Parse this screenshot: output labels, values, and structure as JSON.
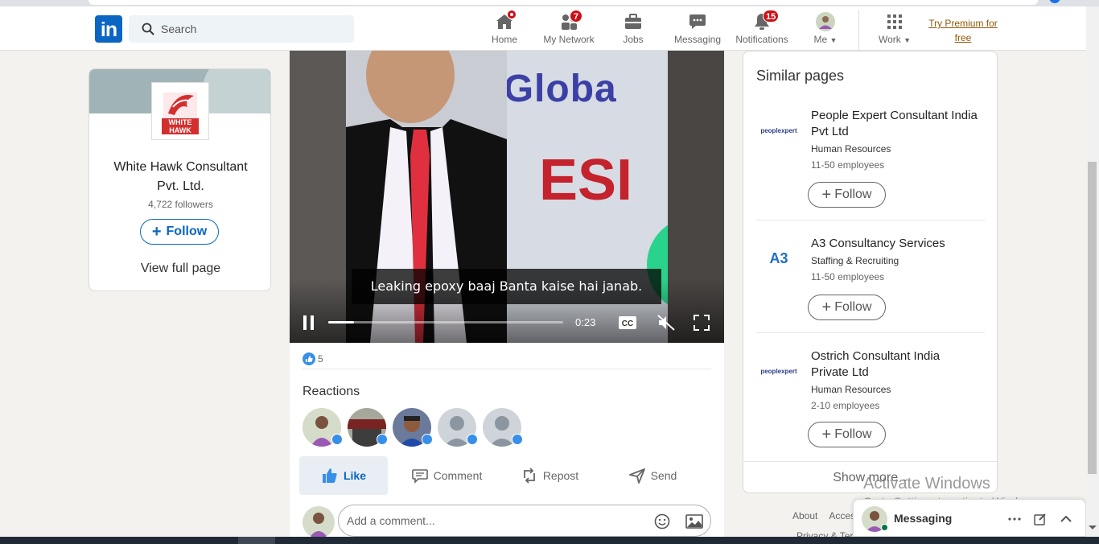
{
  "nav": {
    "logo": "in",
    "search_placeholder": "Search",
    "items": [
      {
        "label": "Home",
        "icon": "home-icon",
        "badge": ""
      },
      {
        "label": "My Network",
        "icon": "network-icon",
        "badge": "7"
      },
      {
        "label": "Jobs",
        "icon": "briefcase-icon",
        "badge": ""
      },
      {
        "label": "Messaging",
        "icon": "chat-icon",
        "badge": ""
      },
      {
        "label": "Notifications",
        "icon": "bell-icon",
        "badge": "15"
      },
      {
        "label": "Me",
        "icon": "avatar",
        "badge": ""
      },
      {
        "label": "Work",
        "icon": "grid-icon",
        "badge": ""
      }
    ],
    "premium": "Try Premium for free"
  },
  "company_card": {
    "name": "White Hawk Consultant Pvt. Ltd.",
    "followers": "4,722 followers",
    "follow_label": "Follow",
    "view_full": "View full page",
    "logo_text": "WHITE HAWK"
  },
  "post": {
    "video": {
      "banner_text": "am Globa",
      "banner_red": "ESI",
      "caption": "Leaking epoxy baaj Banta kaise hai janab.",
      "time": "0:23",
      "progress": 0.11
    },
    "like_count": "5",
    "reactions_title": "Reactions",
    "actions": [
      {
        "label": "Like",
        "icon": "like-icon"
      },
      {
        "label": "Comment",
        "icon": "comment-icon"
      },
      {
        "label": "Repost",
        "icon": "repost-icon"
      },
      {
        "label": "Send",
        "icon": "send-icon"
      }
    ],
    "comment_placeholder": "Add a comment..."
  },
  "similar": {
    "title": "Similar pages",
    "pages": [
      {
        "name": "People Expert Consultant India Pvt Ltd",
        "industry": "Human Resources",
        "size": "11-50 employees",
        "logo": "peoplexpert"
      },
      {
        "name": "A3 Consultancy Services",
        "industry": "Staffing & Recruiting",
        "size": "11-50 employees",
        "logo": "A3"
      },
      {
        "name": "Ostrich Consultant India Private Ltd",
        "industry": "Human Resources",
        "size": "2-10 employees",
        "logo": "peoplexpert"
      }
    ],
    "follow_label": "Follow",
    "show_more": "Show more"
  },
  "footer": {
    "about": "About",
    "access": "Acces",
    "privacy": "Privacy & Ter"
  },
  "watermark": {
    "line1": "Activate Windows",
    "line2": "Go to Settings to activate Windows."
  },
  "messaging_bar": {
    "title": "Messaging"
  },
  "colors": {
    "brand": "#0a66c2",
    "badge": "#cc1016",
    "premium": "#915907"
  }
}
